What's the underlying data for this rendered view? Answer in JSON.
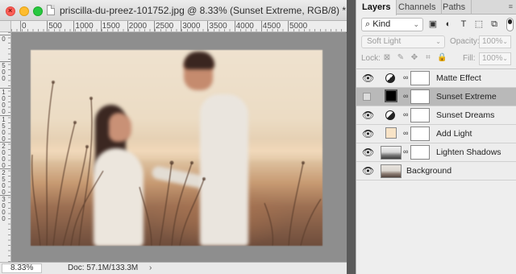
{
  "document": {
    "title": "priscilla-du-preez-101752.jpg @ 8.33% (Sunset Extreme, RGB/8) *",
    "ruler_top_labels": [
      "0",
      "500",
      "1000",
      "1500",
      "2000",
      "2500",
      "3000",
      "3500",
      "4000",
      "4500",
      "5000"
    ],
    "ruler_left_labels": [
      "0",
      "5 0 0",
      "1 0 0 0",
      "1 5 0 0",
      "2 0 0 0",
      "2 5 0 0",
      "3 0 0 0"
    ],
    "photo_alt": "couple in a field at sunset",
    "status": {
      "zoom": "8.33%",
      "doc_size": "Doc: 57.1M/133.3M",
      "arrow": "›"
    }
  },
  "window_controls": {
    "close_glyph": "×",
    "icons": [
      "close-icon",
      "minimize-icon",
      "zoom-icon"
    ]
  },
  "panel": {
    "tabs": [
      "Layers",
      "Channels",
      "Paths"
    ],
    "active_tab": "Layers",
    "menu_glyph": "≡",
    "filter": {
      "kind_label": "Kind",
      "kind_prefix": "⌕",
      "chevron": "⌄",
      "icons": [
        "image-filter-icon",
        "adjustment-filter-icon",
        "type-filter-icon",
        "shape-filter-icon",
        "smart-object-filter-icon"
      ],
      "icon_glyphs": [
        "▣",
        "◐",
        "T",
        "⬚",
        "⧉"
      ]
    },
    "blend_mode": "Soft Light",
    "opacity_label": "Opacity:",
    "opacity_value": "100%",
    "lock_label": "Lock:",
    "lock_icons": [
      "lock-transparency-icon",
      "lock-pixels-icon",
      "lock-position-icon",
      "lock-artboard-icon",
      "lock-all-icon"
    ],
    "lock_glyphs": [
      "⊠",
      "✎",
      "✥",
      "⌗",
      "🔒"
    ],
    "fill_label": "Fill:",
    "fill_value": "100%",
    "layers": [
      {
        "name": "Matte Effect",
        "visible": true,
        "thumb": "adjustment",
        "mask": true,
        "selected": false
      },
      {
        "name": "Sunset Extreme",
        "visible": false,
        "thumb": "black-fill",
        "mask": true,
        "selected": true
      },
      {
        "name": "Sunset Dreams",
        "visible": true,
        "thumb": "adjustment",
        "mask": true,
        "selected": false
      },
      {
        "name": "Add Light",
        "visible": true,
        "thumb": "cream-fill",
        "mask": true,
        "selected": false
      },
      {
        "name": "Lighten Shadows",
        "visible": true,
        "thumb": "bw-photo",
        "mask": true,
        "selected": false
      },
      {
        "name": "Background",
        "visible": true,
        "thumb": "photo",
        "mask": false,
        "selected": false
      }
    ],
    "eye_glyph": "👁",
    "link_glyph": "∞"
  },
  "colors": {
    "selected_layer": "#b9b9b9",
    "panel_bg": "#eeeeee",
    "canvas_bg": "#8e8e8e",
    "cream_fill": "#f8e3c6"
  }
}
